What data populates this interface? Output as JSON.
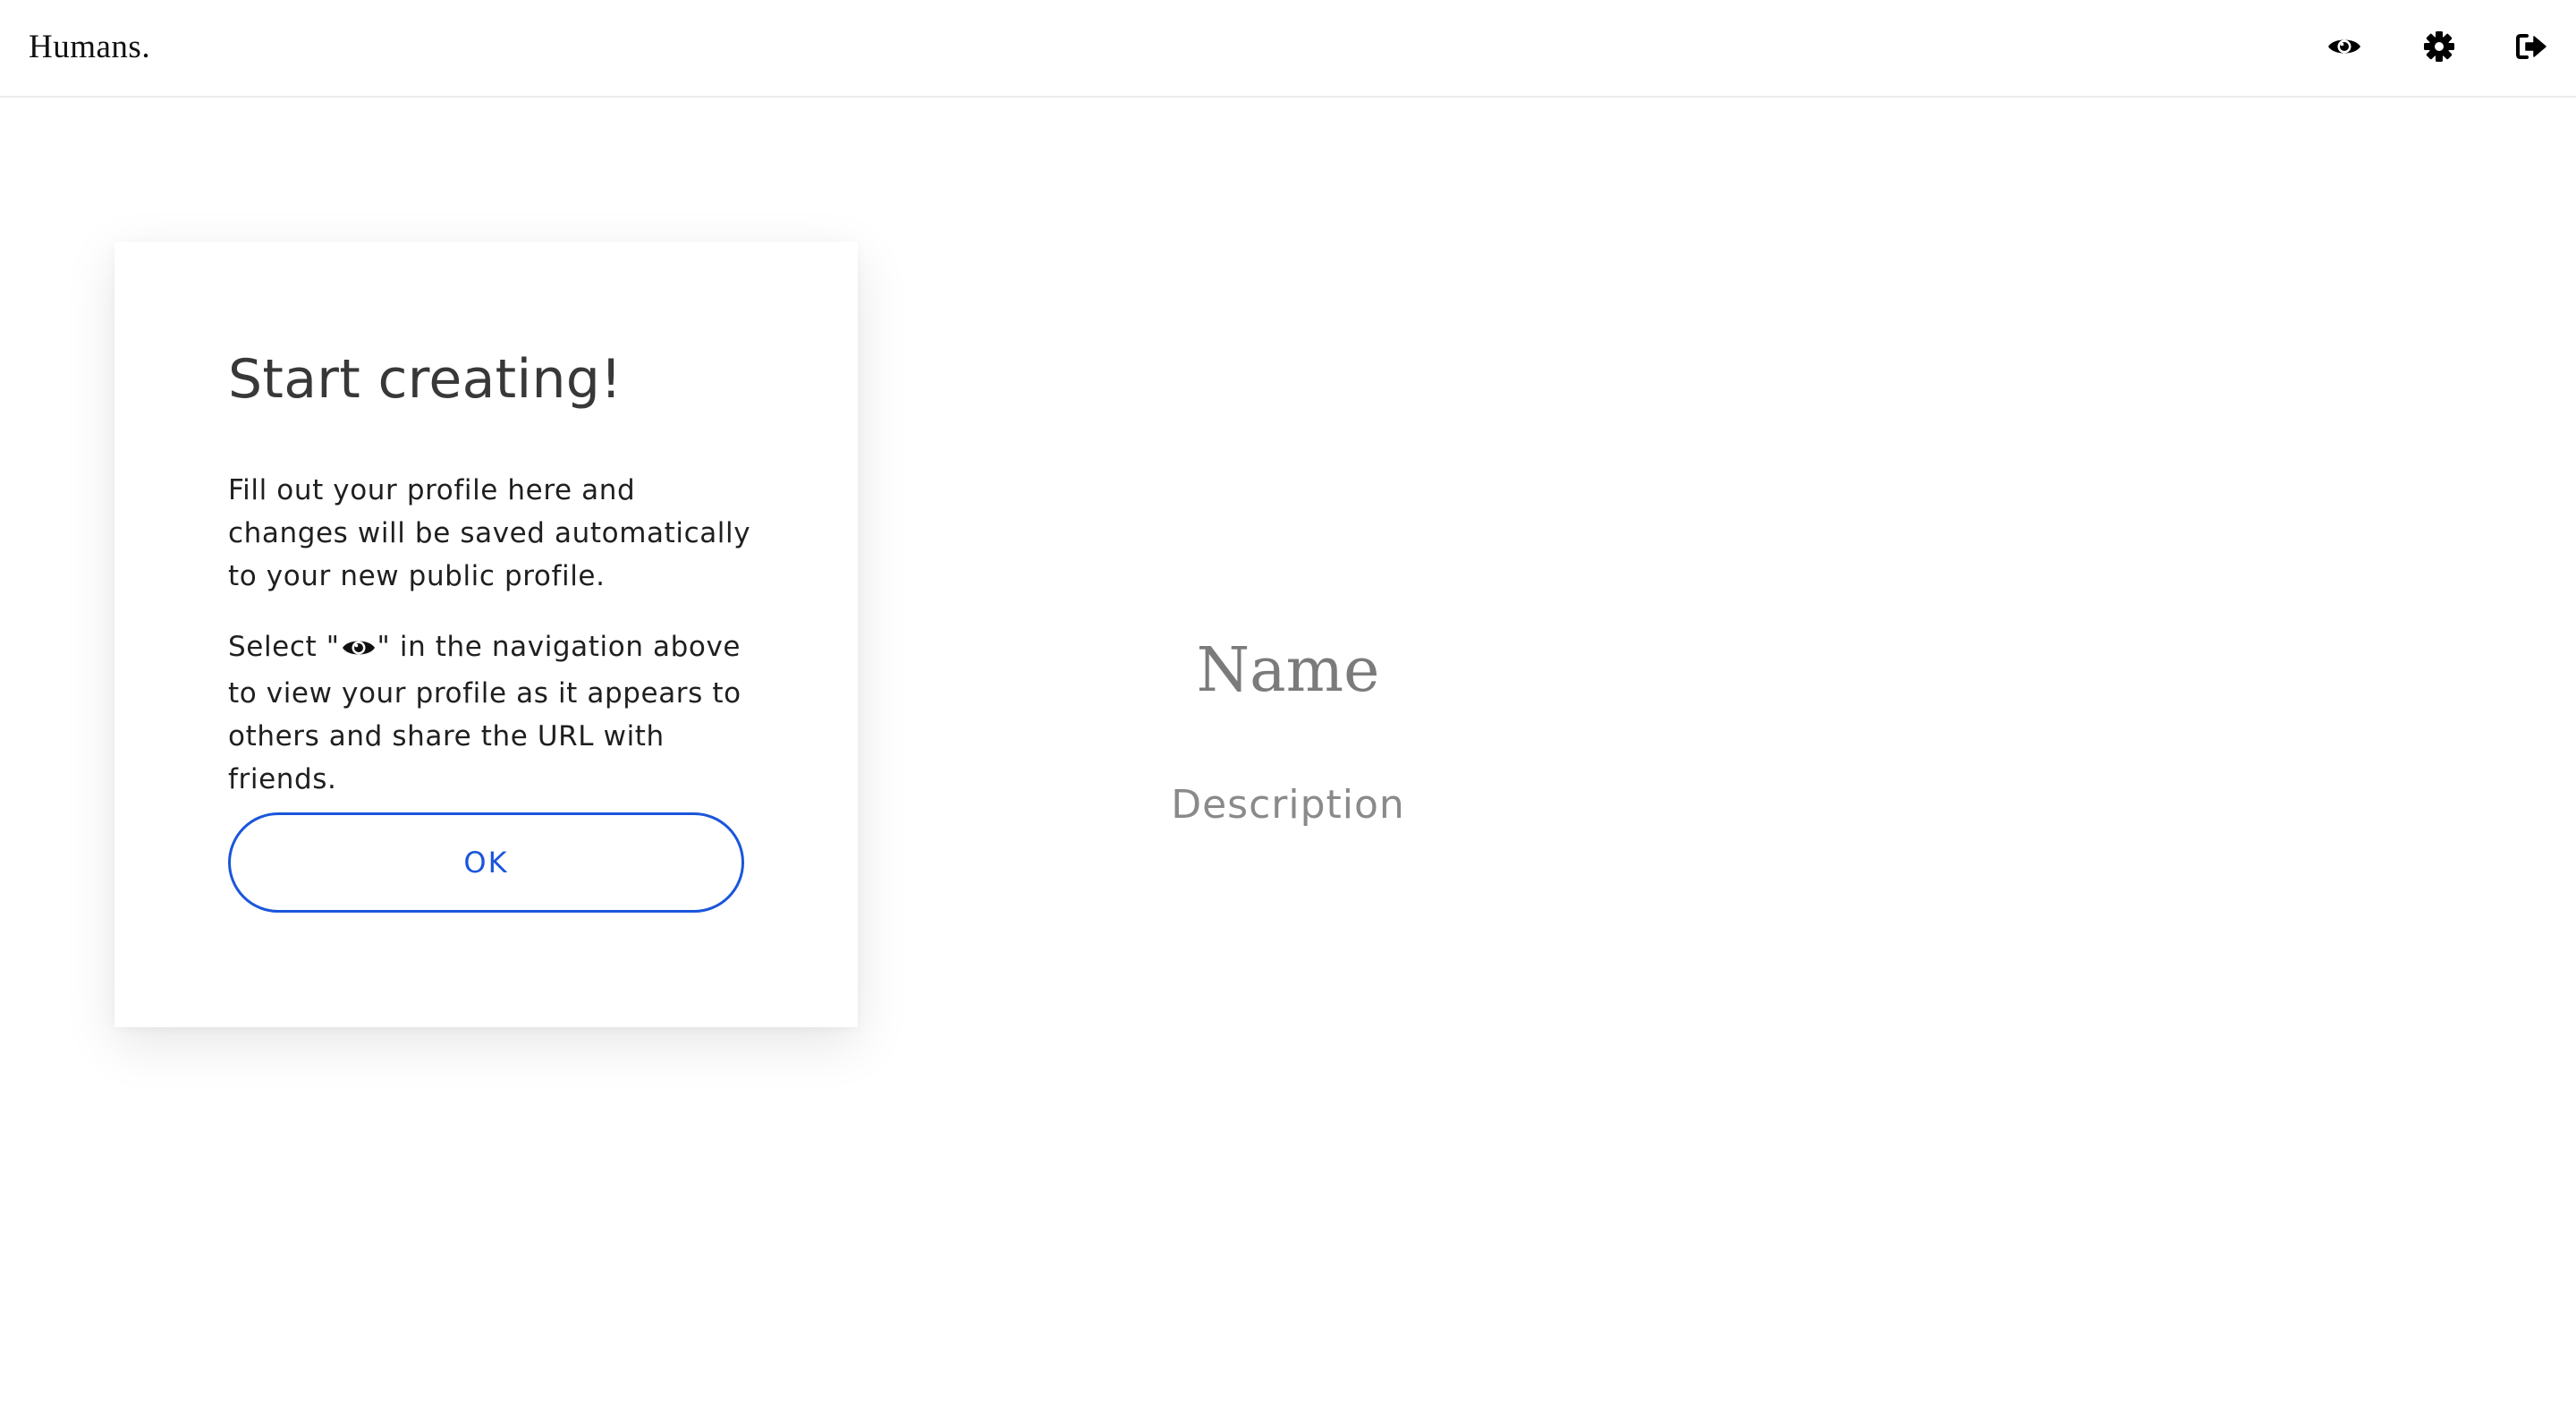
{
  "header": {
    "brand": "Humans.",
    "icons": [
      "eye-icon",
      "gear-icon",
      "sign-out-icon"
    ]
  },
  "modal": {
    "title": "Start creating!",
    "paragraph1": "Fill out your profile here and changes will be saved automatically to your new public profile.",
    "paragraph2_before": "Select \"",
    "paragraph2_icon": "eye-icon",
    "paragraph2_after": "\" in the navigation above to view your profile as it appears to others and share the URL with friends.",
    "ok_label": "OK"
  },
  "profile": {
    "name_placeholder": "Name",
    "description_placeholder": "Description"
  },
  "colors": {
    "accent": "#1a56db",
    "placeholder": "#7b7b7b",
    "divider": "#ececec"
  }
}
